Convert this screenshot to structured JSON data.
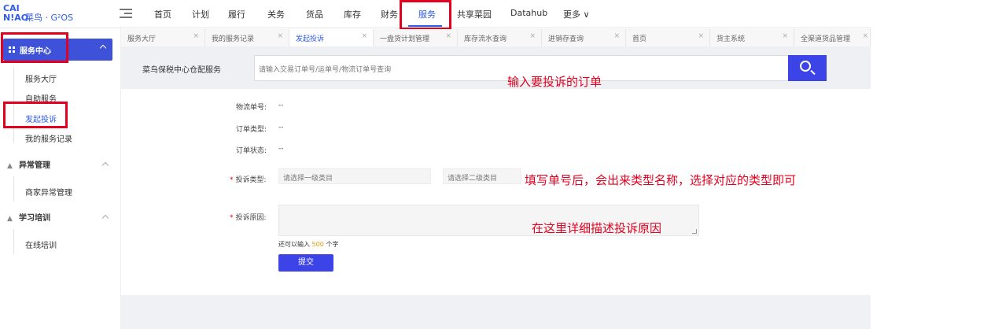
{
  "logo": {
    "line1": "CAI",
    "line2": "N!AO",
    "brand": "菜鸟 · G²OS"
  },
  "topnav": {
    "items": [
      {
        "label": "首页"
      },
      {
        "label": "计划"
      },
      {
        "label": "履行"
      },
      {
        "label": "关务"
      },
      {
        "label": "货品"
      },
      {
        "label": "库存"
      },
      {
        "label": "财务"
      },
      {
        "label": "服务"
      },
      {
        "label": "共享菜园"
      },
      {
        "label": "Datahub"
      },
      {
        "label": "更多 ∨"
      }
    ],
    "active": "服务"
  },
  "sidebar": {
    "header": "服务中心",
    "subitems1": [
      {
        "label": "服务大厅"
      },
      {
        "label": "自助服务"
      },
      {
        "label": "发起投诉"
      },
      {
        "label": "我的服务记录"
      }
    ],
    "group2": {
      "label": "异常管理",
      "items": [
        {
          "label": "商家异常管理"
        }
      ]
    },
    "group3": {
      "label": "学习培训",
      "items": [
        {
          "label": "在线培训"
        }
      ]
    }
  },
  "tabs": [
    {
      "label": "服务大厅"
    },
    {
      "label": "我的服务记录"
    },
    {
      "label": "发起投诉"
    },
    {
      "label": "一盘货计划管理"
    },
    {
      "label": "库存流水查询"
    },
    {
      "label": "进销存查询"
    },
    {
      "label": "首页"
    },
    {
      "label": "货主系统"
    },
    {
      "label": "全渠道货品管理"
    }
  ],
  "active_tab": "发起投诉",
  "search": {
    "label": "菜鸟保税中心仓配服务",
    "placeholder": "请输入交易订单号/运单号/物流订单号查询"
  },
  "form": {
    "logistics_no": {
      "label": "物流单号:",
      "value": "--"
    },
    "order_type": {
      "label": "订单类型:",
      "value": "--"
    },
    "order_status": {
      "label": "订单状态:",
      "value": "--"
    },
    "complaint_type": {
      "label": "投诉类型:",
      "select1": "请选择一级类目",
      "select2": "请选择二级类目"
    },
    "complaint_reason": {
      "label": "投诉原因:"
    },
    "counter": {
      "prefix": "还可以输入",
      "num": "500",
      "suffix": "个字"
    },
    "submit": "提交"
  },
  "annotations": {
    "a1": "输入要投诉的订单",
    "a2": "填写单号后，会出来类型名称，选择对应的类型即可",
    "a3": "在这里详细描述投诉原因"
  },
  "colors": {
    "accent": "#3c44e8",
    "annotation": "#e4001f"
  }
}
